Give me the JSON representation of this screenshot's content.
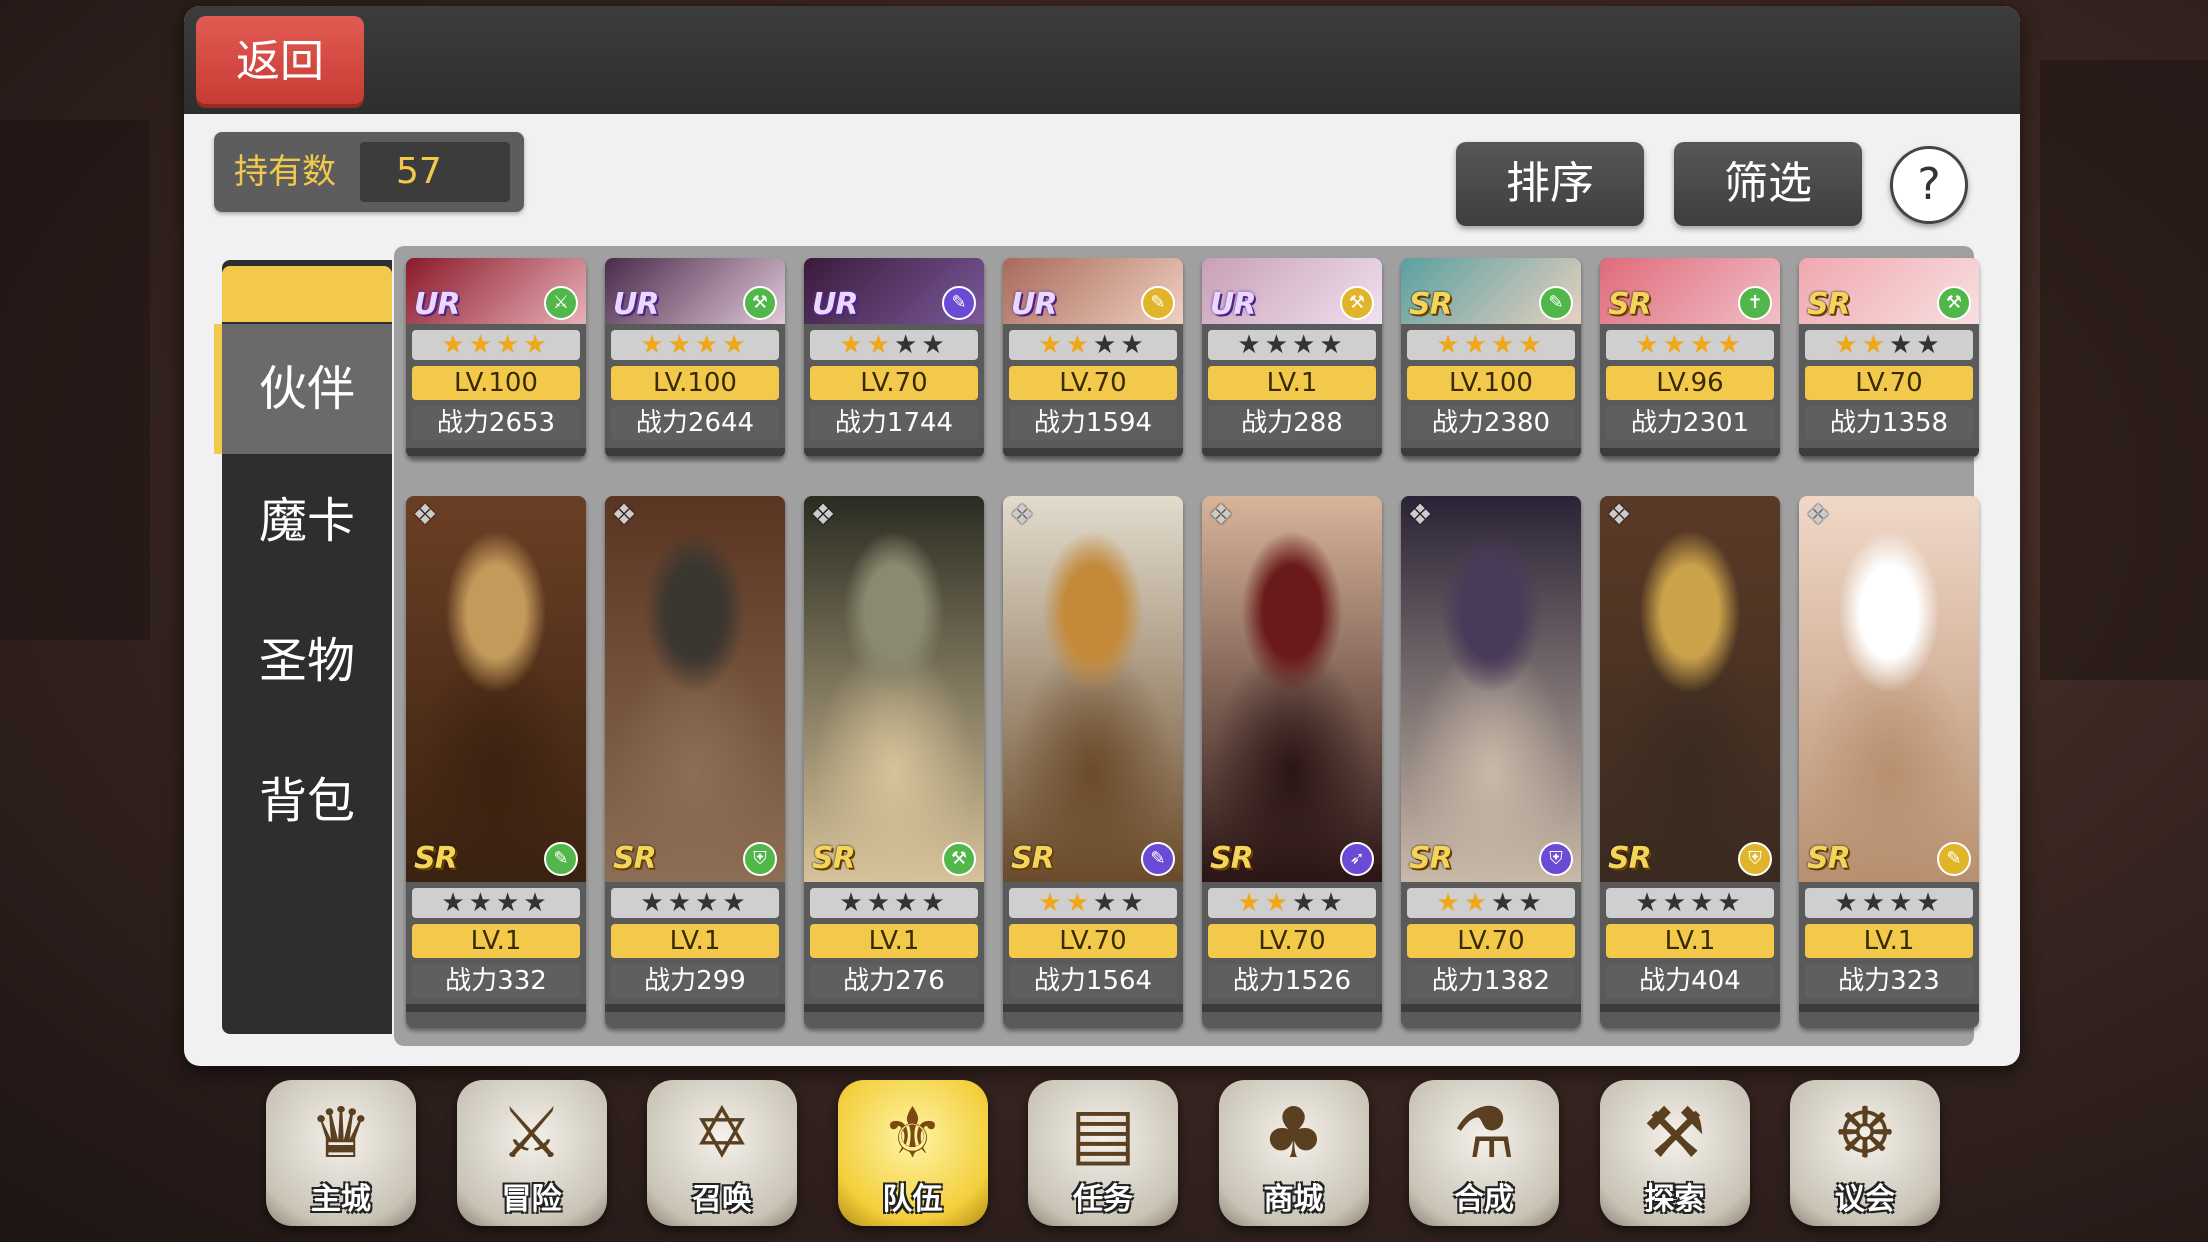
{
  "header": {
    "back_label": "返回",
    "owned_label": "持有数",
    "owned_count": "57",
    "sort_label": "排序",
    "filter_label": "筛选",
    "help_label": "?"
  },
  "side_tabs": [
    {
      "label": "伙伴",
      "active": true
    },
    {
      "label": "魔卡",
      "active": false
    },
    {
      "label": "圣物",
      "active": false
    },
    {
      "label": "背包",
      "active": false
    }
  ],
  "row1": [
    {
      "rarity": "UR",
      "stars": 4,
      "level": "LV.100",
      "power": "战力2653",
      "class_color": "#52b74a",
      "class_icon": "sword-icon"
    },
    {
      "rarity": "UR",
      "stars": 4,
      "level": "LV.100",
      "power": "战力2644",
      "class_color": "#52b74a",
      "class_icon": "axe-icon"
    },
    {
      "rarity": "UR",
      "stars": 2,
      "level": "LV.70",
      "power": "战力1744",
      "class_color": "#6b4bd6",
      "class_icon": "staff-icon"
    },
    {
      "rarity": "UR",
      "stars": 2,
      "level": "LV.70",
      "power": "战力1594",
      "class_color": "#e0b52a",
      "class_icon": "staff-icon"
    },
    {
      "rarity": "UR",
      "stars": 0,
      "level": "LV.1",
      "power": "战力288",
      "class_color": "#e0b52a",
      "class_icon": "axe-icon"
    },
    {
      "rarity": "SR",
      "stars": 4,
      "level": "LV.100",
      "power": "战力2380",
      "class_color": "#52b74a",
      "class_icon": "staff-icon"
    },
    {
      "rarity": "SR",
      "stars": 4,
      "level": "LV.96",
      "power": "战力2301",
      "class_color": "#52b74a",
      "class_icon": "cross-icon"
    },
    {
      "rarity": "SR",
      "stars": 2,
      "level": "LV.70",
      "power": "战力1358",
      "class_color": "#52b74a",
      "class_icon": "axe-icon"
    }
  ],
  "row2": [
    {
      "rarity": "SR",
      "stars": 0,
      "level": "LV.1",
      "power": "战力332",
      "class_color": "#52b74a",
      "class_icon": "staff-icon",
      "art": [
        "#6b3f25",
        "#c49a5a",
        "#3a2210"
      ]
    },
    {
      "rarity": "SR",
      "stars": 0,
      "level": "LV.1",
      "power": "战力299",
      "class_color": "#52b74a",
      "class_icon": "shield-icon",
      "art": [
        "#5a3522",
        "#3a3630",
        "#8c6e54"
      ]
    },
    {
      "rarity": "SR",
      "stars": 0,
      "level": "LV.1",
      "power": "战力276",
      "class_color": "#52b74a",
      "class_icon": "axe-icon",
      "art": [
        "#2a2c22",
        "#8a8a70",
        "#d7c39a"
      ]
    },
    {
      "rarity": "SR",
      "stars": 2,
      "level": "LV.70",
      "power": "战力1564",
      "class_color": "#6b4bd6",
      "class_icon": "staff-icon",
      "art": [
        "#e2dccd",
        "#c48a3a",
        "#6a4a2a"
      ]
    },
    {
      "rarity": "SR",
      "stars": 2,
      "level": "LV.70",
      "power": "战力1526",
      "class_color": "#6b4bd6",
      "class_icon": "bow-icon",
      "art": [
        "#d8b49a",
        "#6a1a1a",
        "#2a1414"
      ]
    },
    {
      "rarity": "SR",
      "stars": 2,
      "level": "LV.70",
      "power": "战力1382",
      "class_color": "#6b4bd6",
      "class_icon": "shield-icon",
      "art": [
        "#2a2336",
        "#4a3a5a",
        "#c9b9a8"
      ]
    },
    {
      "rarity": "SR",
      "stars": 0,
      "level": "LV.1",
      "power": "战力404",
      "class_color": "#e0b52a",
      "class_icon": "shield-icon",
      "art": [
        "#5a3a26",
        "#c9a24a",
        "#3a2a20"
      ]
    },
    {
      "rarity": "SR",
      "stars": 0,
      "level": "LV.1",
      "power": "战力323",
      "class_color": "#e0b52a",
      "class_icon": "staff-icon",
      "art": [
        "#f0d8c8",
        "#ffffff",
        "#b89070"
      ]
    }
  ],
  "row1_art": [
    [
      "#8a1a2a",
      "#e8b0b8"
    ],
    [
      "#4a2a4a",
      "#e0c8d8"
    ],
    [
      "#3a1a3a",
      "#7a5a9a"
    ],
    [
      "#a86a5a",
      "#f0d0c0"
    ],
    [
      "#c8a0b8",
      "#f0e0f0"
    ],
    [
      "#5aa0a0",
      "#e8d0c0"
    ],
    [
      "#e06a7a",
      "#f0c0c8"
    ],
    [
      "#f0a8b0",
      "#f8e0e0"
    ]
  ],
  "nav": [
    {
      "label": "主城",
      "icon": "crown-icon",
      "glyph": "♛",
      "active": false
    },
    {
      "label": "冒险",
      "icon": "crossed-swords-icon",
      "glyph": "⚔",
      "active": false
    },
    {
      "label": "召唤",
      "icon": "summon-card-icon",
      "glyph": "✡",
      "active": false
    },
    {
      "label": "队伍",
      "icon": "team-wings-icon",
      "glyph": "⚜",
      "active": true
    },
    {
      "label": "任务",
      "icon": "quest-book-icon",
      "glyph": "▤",
      "active": false
    },
    {
      "label": "商城",
      "icon": "shop-tree-icon",
      "glyph": "♣",
      "active": false
    },
    {
      "label": "合成",
      "icon": "potion-icon",
      "glyph": "⚗",
      "active": false
    },
    {
      "label": "探索",
      "icon": "shovel-icon",
      "glyph": "⚒",
      "active": false
    },
    {
      "label": "议会",
      "icon": "council-crest-icon",
      "glyph": "☸",
      "active": false
    }
  ]
}
